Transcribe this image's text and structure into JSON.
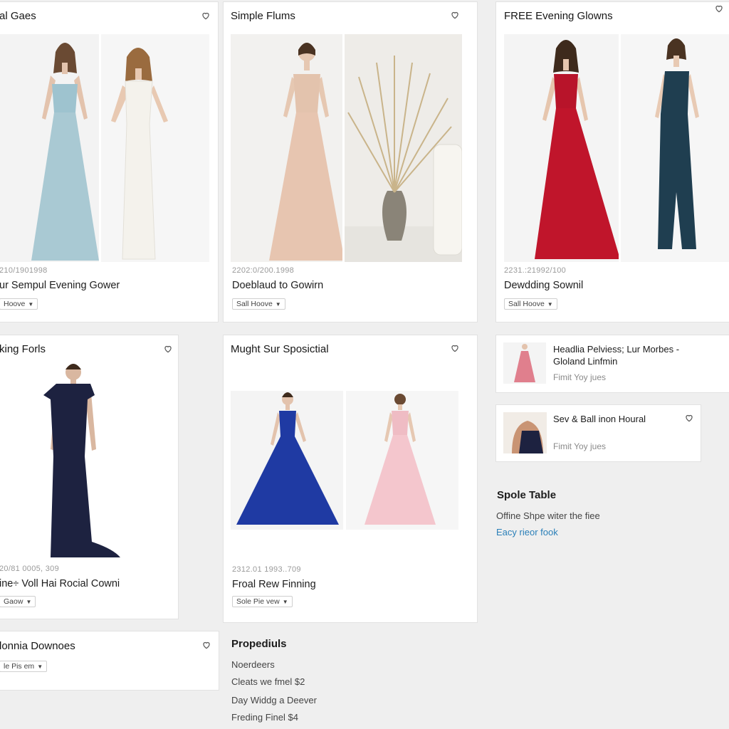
{
  "cards": {
    "c1": {
      "title": "al Gaes",
      "meta": "210/1901998",
      "name": "ur Sempul Evening Gower",
      "dropdown": "Hoove"
    },
    "c2": {
      "title": "Simple Flums",
      "meta": "2202:0/200.1998",
      "name": "Doeblaud to Gowirn",
      "dropdown": "Sall Hoove"
    },
    "c3": {
      "title": "FREE Evening Glowns",
      "meta": "2231.:21992/100",
      "name": "Dewdding Sownil",
      "dropdown": "Sall Hoove"
    },
    "c4": {
      "title": "king Forls",
      "meta": "20/81 0005, 309",
      "name": "ine÷ Voll Hai Rocial Cowni",
      "dropdown": "Gaow"
    },
    "c5": {
      "title": "Mught Sur Sposictial",
      "meta": "2312.01 1993..709",
      "name": "Froal Rew Finning",
      "dropdown": "Sole Pie vew"
    },
    "c6": {
      "title": "lonnia Downoes",
      "dropdown": "le Pis em"
    }
  },
  "mini": {
    "m1": {
      "title": "Headlia Pelviess; Lur Morbes - Gloland Linfmin",
      "sub": "Fimit Yoy jues"
    },
    "m2": {
      "title": "Sev & Ball inon Houral",
      "sub": "Fimit Yoy jues"
    }
  },
  "table_section": {
    "title": "Spole Table",
    "line": "Offine Shpe witer the fiee",
    "link": "Eacy rieor fook"
  },
  "properties": {
    "title": "Propediuls",
    "items": [
      "Noerdeers",
      "Cleats we fmel $2",
      "Day Widdg a Deever",
      "Freding Finel $4"
    ]
  },
  "colors": {
    "ice_blue": "#a9c9d3",
    "ivory": "#f4f2ec",
    "blush": "#e7c5b0",
    "crimson": "#c0152b",
    "teal_sequin": "#1f3e50",
    "navy": "#1d2240",
    "royal": "#1f3aa3",
    "pink": "#f4c6cd",
    "link": "#2a7fb8"
  },
  "icons": {
    "favorite": "heart-outline-icon",
    "dropdown": "caret-down-icon"
  }
}
